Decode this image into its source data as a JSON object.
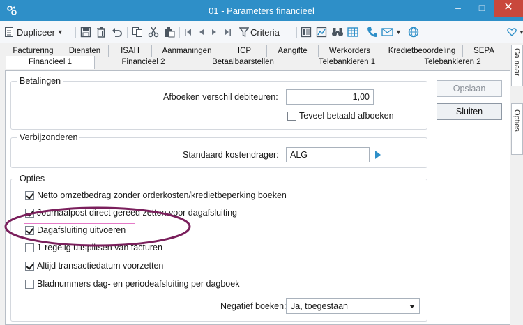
{
  "window": {
    "title": "01 - Parameters financieel",
    "min_symbol": "–",
    "max_symbol": "□",
    "close_symbol": "✕",
    "accent": "#2e8fc8"
  },
  "toolbar": {
    "duplicate_label": "Dupliceer",
    "criteria_label": "Criteria"
  },
  "tabs": {
    "row1": [
      "Facturering",
      "Diensten",
      "ISAH",
      "Aanmaningen",
      "ICP",
      "Aangifte",
      "Werkorders",
      "Kredietbeoordeling",
      "SEPA"
    ],
    "row2": [
      "Financieel 1",
      "Financieel 2",
      "Betaalbaarstellen",
      "Telebankieren 1",
      "Telebankieren 2"
    ],
    "active": "Financieel 1"
  },
  "side_tabs": [
    "Ga naar",
    "Opties"
  ],
  "betalingen": {
    "title": "Betalingen",
    "afboeken_label": "Afboeken verschil debiteuren:",
    "afboeken_value": "1,00",
    "teveel_label": "Teveel betaald afboeken",
    "teveel_checked": false
  },
  "verbijzonderen": {
    "title": "Verbijzonderen",
    "kostendrager_label": "Standaard kostendrager:",
    "kostendrager_value": "ALG"
  },
  "opties": {
    "title": "Opties",
    "items": [
      {
        "label": "Netto omzetbedrag zonder orderkosten/kredietbeperking boeken",
        "checked": true
      },
      {
        "label": "Journaalpost direct gereed zetten voor dagafsluiting",
        "checked": true
      },
      {
        "label": "Dagafsluiting uitvoeren",
        "checked": true
      },
      {
        "label": "1-regelig uitsplitsen van facturen",
        "checked": false
      },
      {
        "label": "Altijd transactiedatum voorzetten",
        "checked": true
      },
      {
        "label": "Bladnummers dag- en periodeafsluiting per dagboek",
        "checked": false
      }
    ],
    "negatief_label": "Negatief boeken:",
    "negatief_value": "Ja, toegestaan"
  },
  "buttons": {
    "opslaan": "Opslaan",
    "sluiten": "Sluiten"
  },
  "colors": {
    "annotation": "#7a1f5c",
    "focus": "#e57ac8"
  }
}
